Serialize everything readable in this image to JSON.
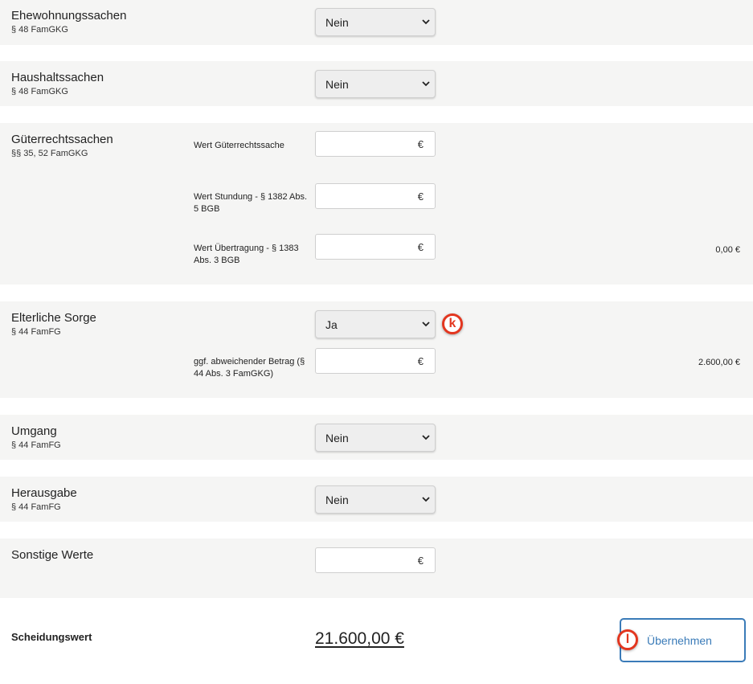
{
  "currency_symbol": "€",
  "sections": {
    "ehewohnung": {
      "title": "Ehewohnungssachen",
      "sub": "§ 48 FamGKG",
      "select_value": "Nein"
    },
    "haushalt": {
      "title": "Haushaltssachen",
      "sub": "§ 48 FamGKG",
      "select_value": "Nein"
    },
    "gueterrecht": {
      "title": "Güterrechtssachen",
      "sub": "§§ 35, 52 FamGKG",
      "fields": {
        "wert": "Wert Güterrechtssache",
        "stundung": "Wert Stundung - § 1382 Abs. 5 BGB",
        "uebertragung": "Wert Übertragung - § 1383 Abs. 3 BGB"
      },
      "amount": "0,00 €"
    },
    "sorge": {
      "title": "Elterliche Sorge",
      "sub": "§ 44 FamFG",
      "select_value": "Ja",
      "field_label": "ggf. abweichender Betrag (§ 44 Abs. 3 FamGKG)",
      "amount": "2.600,00 €"
    },
    "umgang": {
      "title": "Umgang",
      "sub": "§ 44 FamFG",
      "select_value": "Nein"
    },
    "herausgabe": {
      "title": "Herausgabe",
      "sub": "§ 44 FamFG",
      "select_value": "Nein"
    },
    "sonstige": {
      "title": "Sonstige Werte"
    }
  },
  "total": {
    "label": "Scheidungswert",
    "value": "21.600,00 €",
    "button_label": "Übernehmen"
  },
  "markers": {
    "k": "k",
    "l": "l"
  },
  "colors": {
    "section_bg": "#f5f5f4",
    "marker": "#e3361f",
    "button": "#3a7bb8"
  }
}
